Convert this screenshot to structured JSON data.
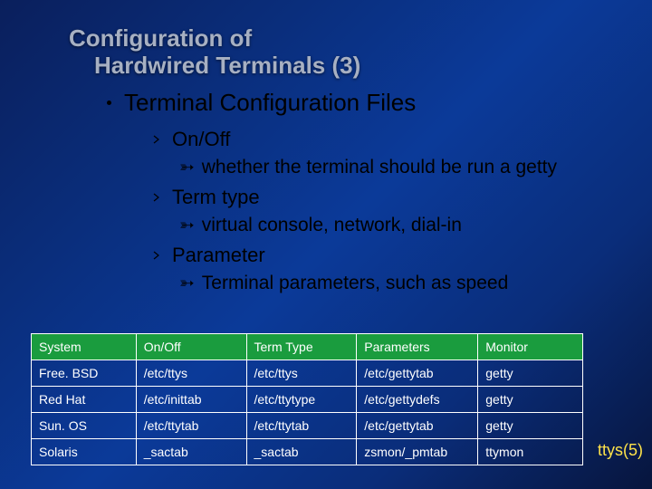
{
  "title": {
    "line1": "Configuration of",
    "line2": "Hardwired Terminals (3)"
  },
  "main_item": "Terminal Configuration Files",
  "bullets": [
    {
      "label": "On/Off",
      "detail": "whether the terminal should be run a getty"
    },
    {
      "label": "Term type",
      "detail": "virtual console, network, dial-in"
    },
    {
      "label": "Parameter",
      "detail": "Terminal parameters, such as speed"
    }
  ],
  "table": {
    "headers": [
      "System",
      "On/Off",
      "Term Type",
      "Parameters",
      "Monitor"
    ],
    "rows": [
      [
        "Free. BSD",
        "/etc/ttys",
        "/etc/ttys",
        "/etc/gettytab",
        "getty"
      ],
      [
        "Red Hat",
        "/etc/inittab",
        "/etc/ttytype",
        "/etc/gettydefs",
        "getty"
      ],
      [
        "Sun. OS",
        "/etc/ttytab",
        "/etc/ttytab",
        "/etc/gettytab",
        "getty"
      ],
      [
        "Solaris",
        "_sactab",
        "_sactab",
        "zsmon/_pmtab",
        "ttymon"
      ]
    ]
  },
  "footnote": "ttys(5)"
}
